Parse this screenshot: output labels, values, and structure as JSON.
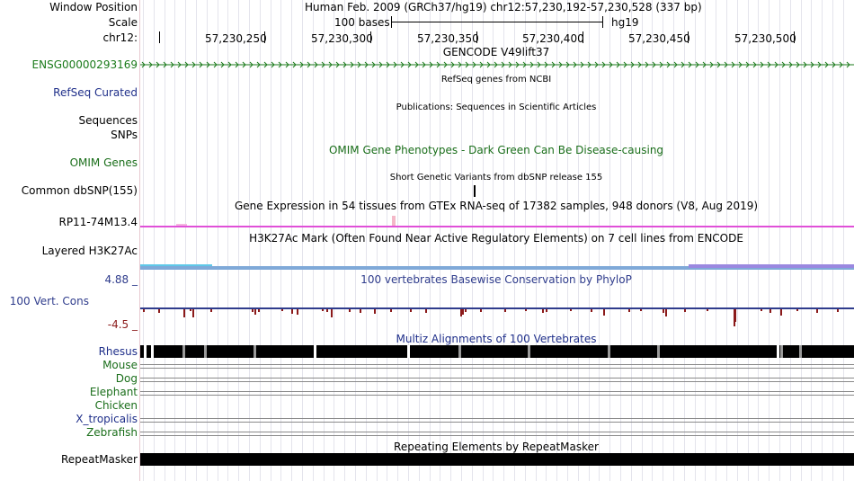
{
  "header": {
    "window_position_label": "Window Position",
    "scale_label": "Scale",
    "chrom_label": "chr12:",
    "window_position_text": "Human Feb. 2009 (GRCh37/hg19)   chr12:57,230,192-57,230,528 (337 bp)",
    "scale_text": "100 bases",
    "assembly": "hg19",
    "ruler_ticks": [
      "57,230,250",
      "57,230,300",
      "57,230,350",
      "57,230,400",
      "57,230,450",
      "57,230,500"
    ]
  },
  "tracks": {
    "gencode": {
      "title": "GENCODE V49lift37",
      "label": "ENSG00000293169",
      "color": "#1a7a1a"
    },
    "refseq": {
      "title": "RefSeq genes from NCBI",
      "label": "RefSeq Curated",
      "color": "#1f2f8a"
    },
    "publications": {
      "title": "Publications: Sequences in Scientific Articles",
      "label": "Sequences"
    },
    "snps": {
      "label": "SNPs"
    },
    "omim": {
      "title": "OMIM Gene Phenotypes - Dark Green Can Be Disease-causing",
      "label": "OMIM Genes",
      "color": "#1a6e1a"
    },
    "dbsnp": {
      "title": "Short Genetic Variants from dbSNP release 155",
      "label": "Common dbSNP(155)"
    },
    "gtex": {
      "title": "Gene Expression in 54 tissues from GTEx RNA-seq of 17382 samples, 948 donors (V8, Aug 2019)",
      "label": "RP11-74M13.4",
      "color": "#d63fd6"
    },
    "h3k27ac": {
      "title": "H3K27Ac Mark (Often Found Near Active Regulatory Elements) on 7 cell lines from ENCODE",
      "label": "Layered H3K27Ac"
    },
    "phylop": {
      "title": "100 vertebrates Basewise Conservation by PhyloP",
      "label": "100 Vert. Cons",
      "max": "4.88 _",
      "min": "-4.5 _",
      "color": "#2f3c8c",
      "neg_color": "#8b1a1a"
    },
    "multiz": {
      "title": "Multiz Alignments of 100 Vertebrates",
      "species": [
        "Rhesus",
        "Mouse",
        "Dog",
        "Elephant",
        "Chicken",
        "X_tropicalis",
        "Zebrafish"
      ],
      "color": "#1f2f8a"
    },
    "repeatmasker": {
      "title": "Repeating Elements by RepeatMasker",
      "label": "RepeatMasker"
    }
  }
}
